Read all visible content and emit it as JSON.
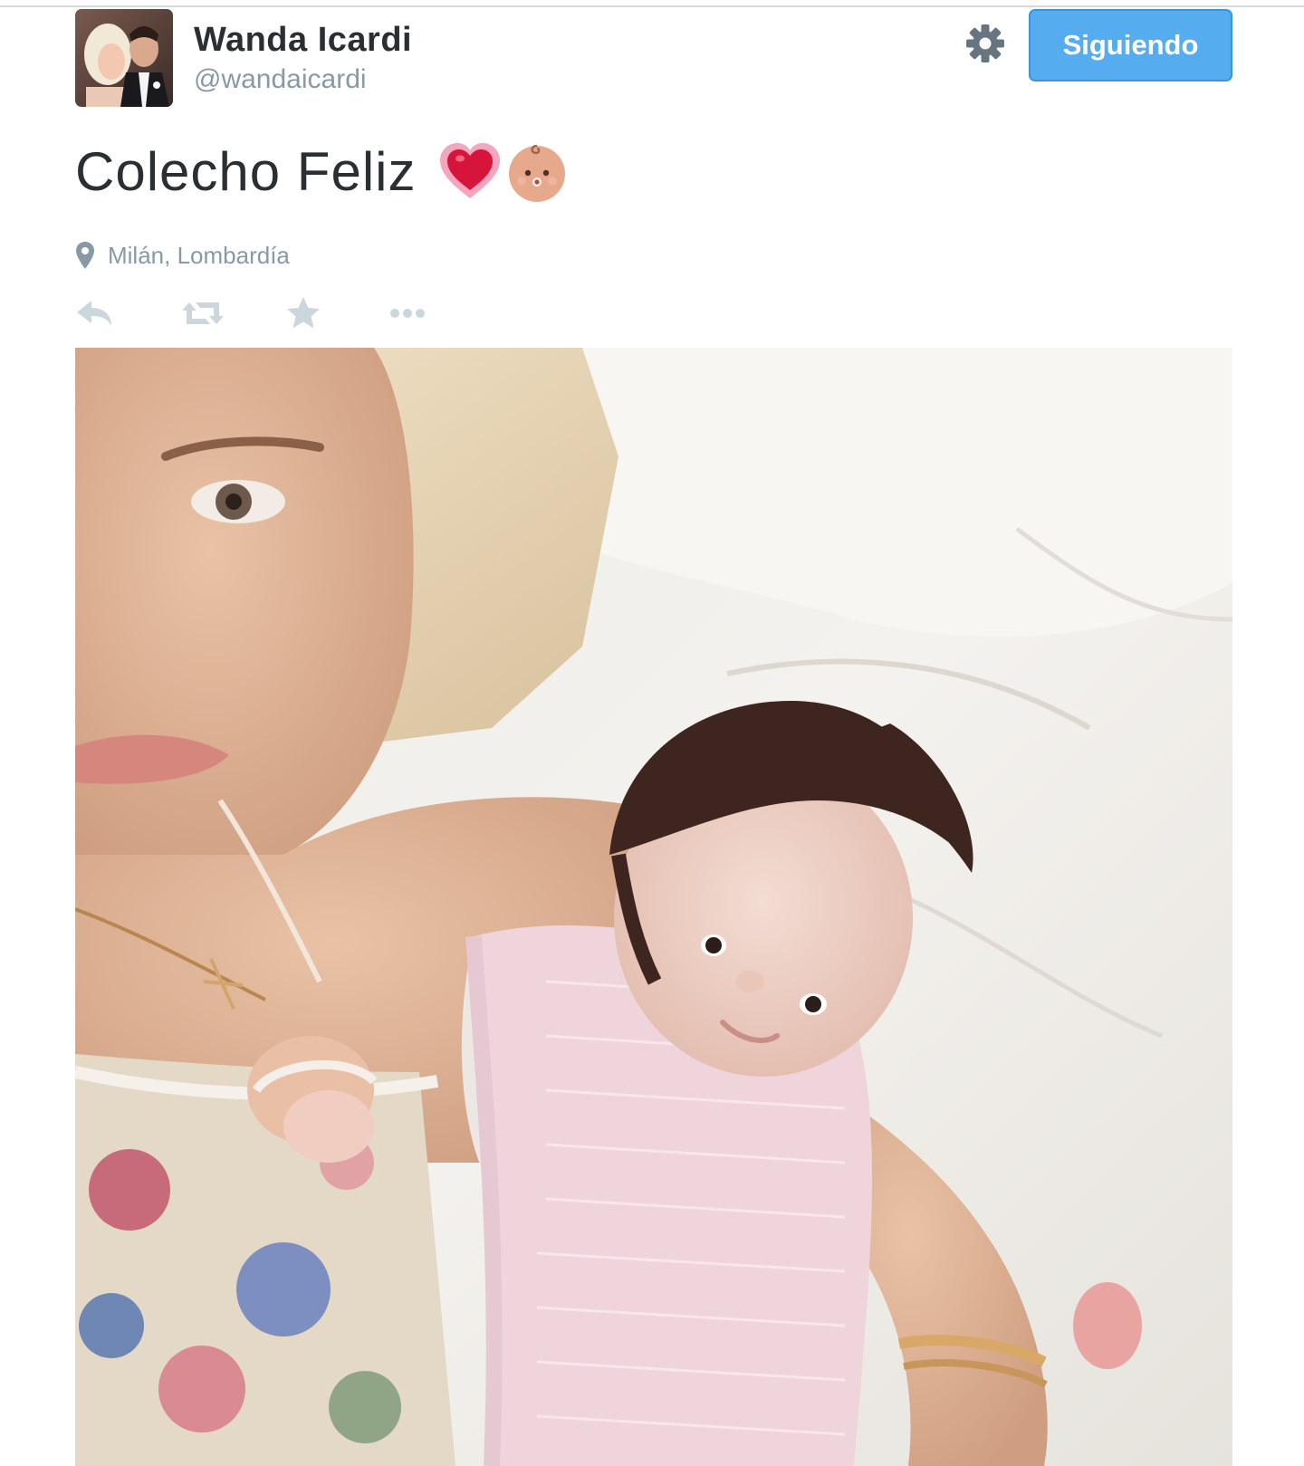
{
  "user": {
    "display_name": "Wanda Icardi",
    "handle": "@wandaicardi"
  },
  "follow_button": {
    "label": "Siguiendo",
    "color": "#55acee"
  },
  "tweet": {
    "text": "Colecho Feliz",
    "emojis": [
      "heart-icon",
      "baby-face-icon"
    ],
    "location": "Milán, Lombardía"
  },
  "actions": [
    "reply-icon",
    "retweet-icon",
    "favorite-icon",
    "more-icon"
  ],
  "colors": {
    "text": "#292f33",
    "muted": "#8899a6",
    "action_icon": "#ccd6dd"
  }
}
